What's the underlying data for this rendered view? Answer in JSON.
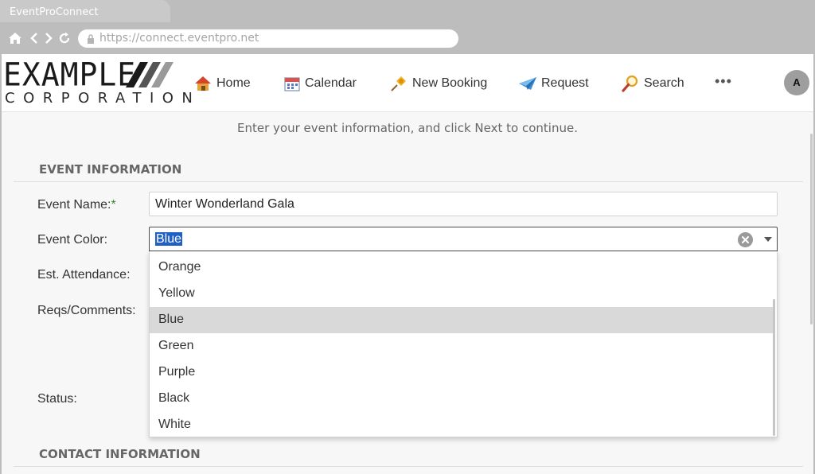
{
  "browser": {
    "tab_title": "EventProConnect",
    "url": "https://connect.eventpro.net"
  },
  "logo": {
    "line1": "EXAMPLE",
    "line2": "CORPORATION"
  },
  "nav": {
    "items": [
      {
        "label": "Home",
        "icon": "home-icon"
      },
      {
        "label": "Calendar",
        "icon": "calendar-icon"
      },
      {
        "label": "New Booking",
        "icon": "pushpin-icon"
      },
      {
        "label": "Request",
        "icon": "paper-plane-icon"
      },
      {
        "label": "Search",
        "icon": "magnifier-icon"
      }
    ],
    "more": "•••",
    "avatar_initial": "A"
  },
  "instructions": "Enter your event information, and click Next to continue.",
  "event_info": {
    "title": "EVENT INFORMATION",
    "event_name_label": "Event Name:",
    "required_mark": "*",
    "event_name_value": "Winter Wonderland Gala",
    "event_color_label": "Event Color:",
    "event_color_value": "Blue",
    "attendance_label": "Est. Attendance:",
    "comments_label": "Reqs/Comments:",
    "status_label": "Status:"
  },
  "color_options": [
    "Orange",
    "Yellow",
    "Blue",
    "Green",
    "Purple",
    "Black",
    "White"
  ],
  "contact_info": {
    "title": "CONTACT INFORMATION"
  },
  "colors": {
    "selection": "#1e5fc8",
    "highlight": "#d9d9d9",
    "required": "#2e8b2e"
  }
}
